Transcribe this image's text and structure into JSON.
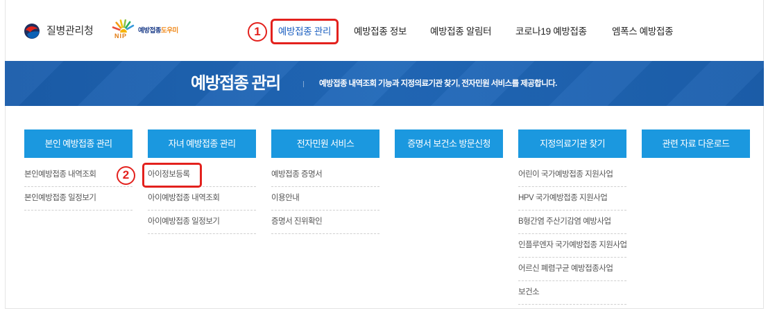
{
  "header": {
    "agency_name": "질병관리청",
    "nip_logo": {
      "badge": "NIP",
      "name_main": "예방접종",
      "name_accent": "도우미"
    },
    "nav": [
      {
        "label": "예방접종 관리",
        "active": true
      },
      {
        "label": "예방접종 정보"
      },
      {
        "label": "예방접종 알림터"
      },
      {
        "label": "코로나19 예방접종"
      },
      {
        "label": "엠폭스 예방접종"
      }
    ]
  },
  "banner": {
    "title": "예방접종 관리",
    "description": "예방접종 내역조회 기능과 지정의료기관 찾기, 전자민원 서비스를 제공합니다."
  },
  "menu": {
    "columns": [
      {
        "title": "본인 예방접종 관리",
        "items": [
          "본인예방접종 내역조회",
          "본인예방접종 일정보기"
        ]
      },
      {
        "title": "자녀 예방접종 관리",
        "items": [
          "아이정보등록",
          "아이예방접종 내역조회",
          "아이예방접종 일정보기"
        ]
      },
      {
        "title": "전자민원 서비스",
        "items": [
          "예방접종 증명서",
          "이용안내",
          "증명서 진위확인"
        ]
      },
      {
        "title": "증명서 보건소 방문신청",
        "items": []
      },
      {
        "title": "지정의료기관 찾기",
        "items": [
          "어린이 국가예방접종 지원사업",
          "HPV 국가예방접종 지원사업",
          "B형간염 주산기감염 예방사업",
          "인플루엔자 국가예방접종 지원사업",
          "어르신 폐렴구균 예방접종사업",
          "보건소"
        ]
      },
      {
        "title": "관련 자료 다운로드",
        "items": []
      }
    ]
  },
  "annotations": {
    "step_1": "1",
    "step_2": "2"
  },
  "icons": {
    "agency_logo": "kdca-logo-icon",
    "nip_logo": "sun-rays-icon"
  },
  "colors": {
    "annotation_red": "#e3211d",
    "nav_active": "#1b5fc0",
    "banner_blue": "#1e64b4",
    "menu_button_blue": "#1b98df",
    "nip_orange": "#f08a1c",
    "nip_navy": "#1e3f8a"
  }
}
